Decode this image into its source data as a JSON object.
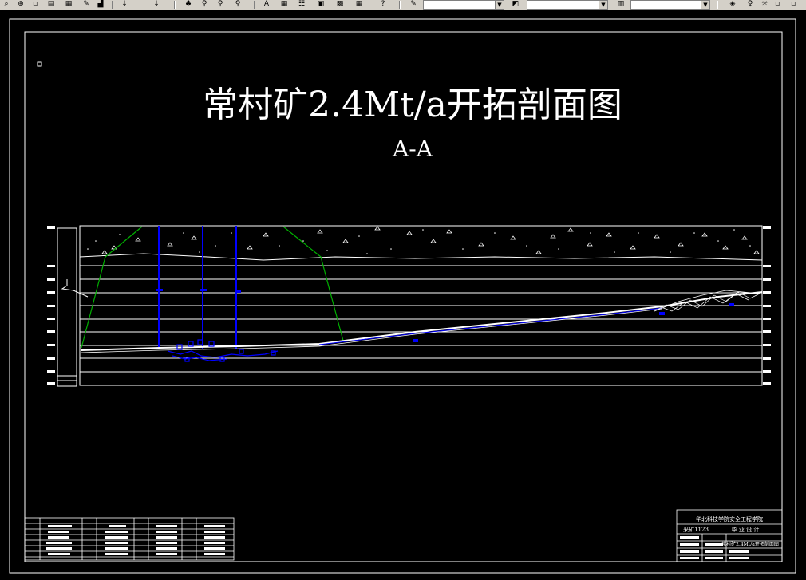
{
  "toolbar": {
    "icons": [
      "zoom-icon",
      "new-file-icon",
      "open-folder-icon",
      "brush-icon",
      "paste-icon",
      "undo-icon",
      "redo-icon",
      "color-icon",
      "zoom-realtime-icon",
      "zoom-window-icon",
      "zoom-previous-icon",
      "text-style-icon",
      "layer-tool-icon",
      "properties-icon",
      "design-center-icon",
      "table-icon",
      "help-icon",
      "match-properties-icon",
      "layers-icon",
      "layer-state-icon"
    ]
  },
  "drawing": {
    "title": "常村矿2.4Mt/a开拓剖面图",
    "subtitle": "A-A"
  },
  "title_block": {
    "school": "华北科技学院安全工程学院",
    "class_label": "采矿1123",
    "design_label": "毕 业 设 计",
    "drawing_name": "常村矿2.4Mt/a开拓剖面图"
  },
  "colors": {
    "background": "#000000",
    "lines": "#ffffff",
    "shafts": "#0000ff",
    "slopes": "#00b000"
  }
}
